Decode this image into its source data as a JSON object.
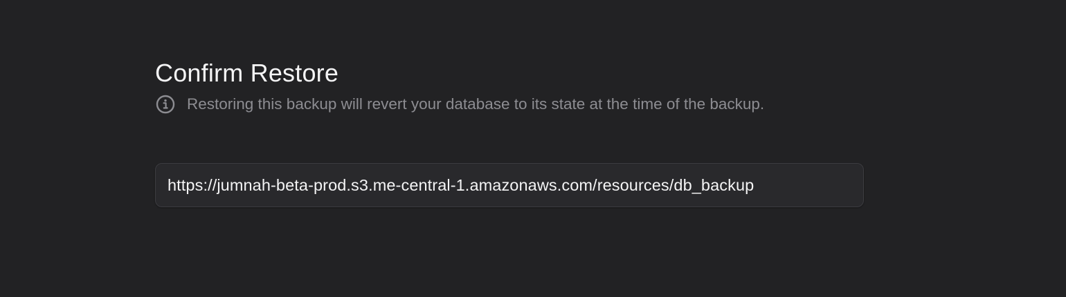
{
  "dialog": {
    "title": "Confirm Restore",
    "info_icon": "info-circle-icon",
    "info_text": "Restoring this backup will revert your database to its state at the time of the backup.",
    "backup_url": "https://jumnah-beta-prod.s3.me-central-1.amazonaws.com/resources/db_backup"
  },
  "colors": {
    "background": "#222224",
    "title": "#f4f4f5",
    "muted_text": "#8d8d92",
    "field_background": "#29292c",
    "field_border": "#3c3c40"
  }
}
